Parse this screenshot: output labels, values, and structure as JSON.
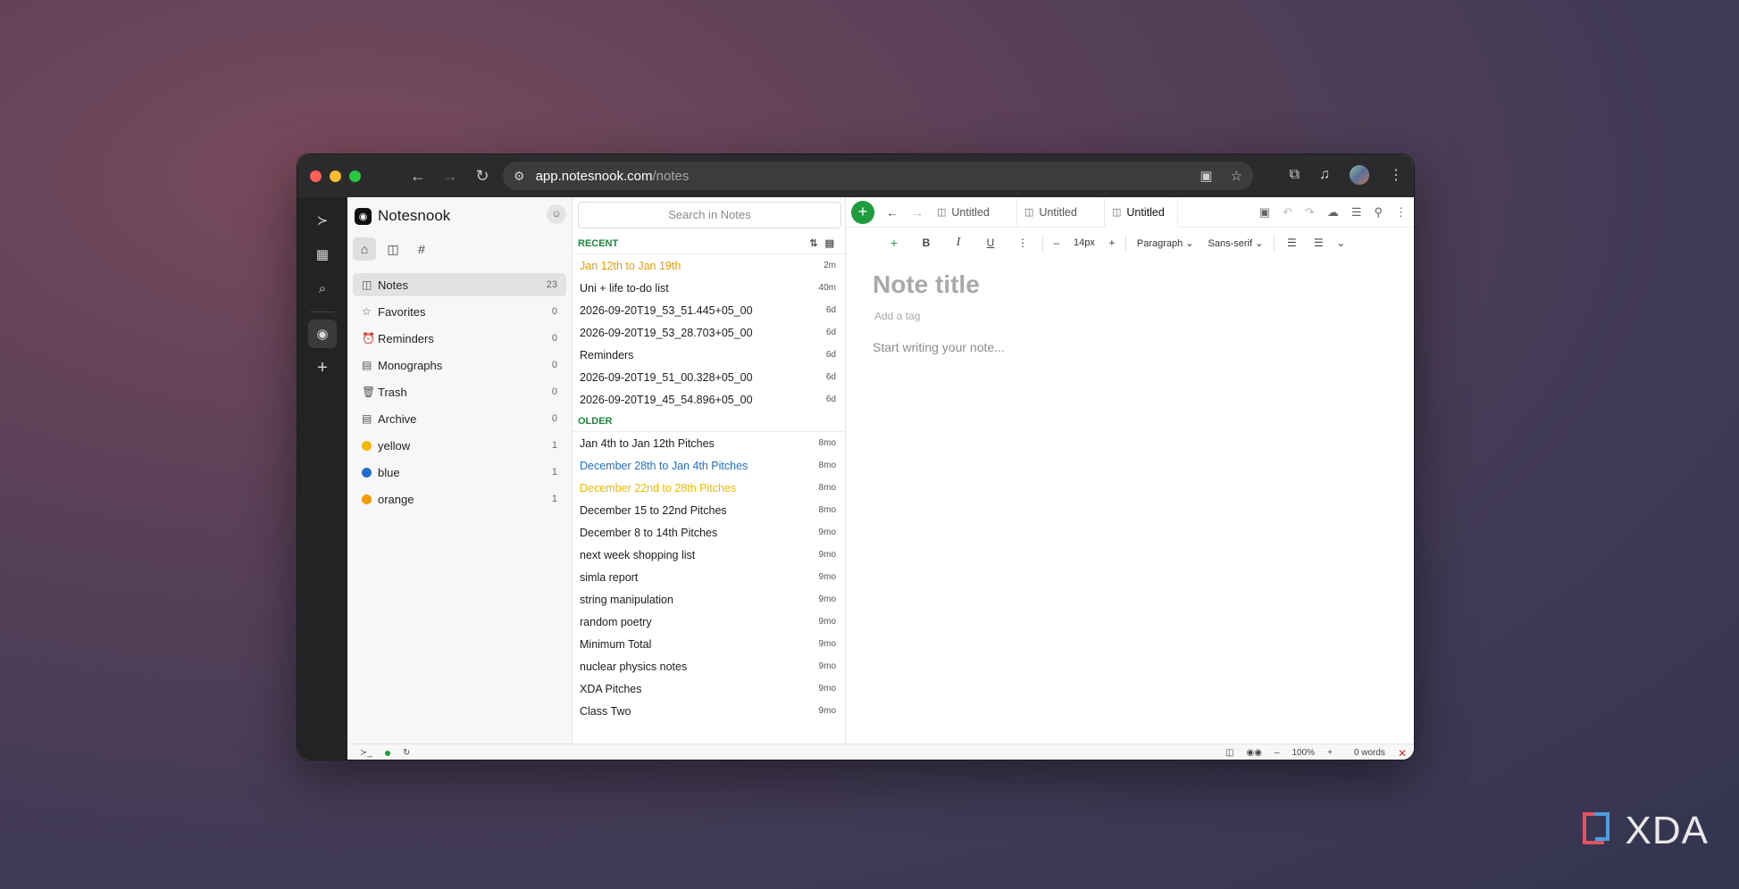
{
  "browser": {
    "url_host": "app.notesnook.com",
    "url_path": "/notes"
  },
  "sidebar": {
    "brand": "Notesnook",
    "items": [
      {
        "label": "Notes",
        "count": "23",
        "icon": "note-icon"
      },
      {
        "label": "Favorites",
        "count": "0",
        "icon": "star-icon"
      },
      {
        "label": "Reminders",
        "count": "0",
        "icon": "alarm-icon"
      },
      {
        "label": "Monographs",
        "count": "0",
        "icon": "monograph-icon"
      },
      {
        "label": "Trash",
        "count": "0",
        "icon": "trash-icon"
      },
      {
        "label": "Archive",
        "count": "0",
        "icon": "archive-icon"
      }
    ],
    "colors": [
      {
        "label": "yellow",
        "count": "1",
        "hex": "#f5b800"
      },
      {
        "label": "blue",
        "count": "1",
        "hex": "#1f6fd1"
      },
      {
        "label": "orange",
        "count": "1",
        "hex": "#f59b00"
      }
    ]
  },
  "notelist": {
    "search_placeholder": "Search in Notes",
    "recent_label": "RECENT",
    "older_label": "OLDER",
    "recent": [
      {
        "title": "Jan 12th to Jan 19th",
        "time": "2m",
        "color": "#f59b00"
      },
      {
        "title": "Uni + life to-do list",
        "time": "40m",
        "color": ""
      },
      {
        "title": "2026-09-20T19_53_51.445+05_00",
        "time": "6d",
        "color": ""
      },
      {
        "title": "2026-09-20T19_53_28.703+05_00",
        "time": "6d",
        "color": ""
      },
      {
        "title": "Reminders",
        "time": "6d",
        "color": ""
      },
      {
        "title": "2026-09-20T19_51_00.328+05_00",
        "time": "6d",
        "color": ""
      },
      {
        "title": "2026-09-20T19_45_54.896+05_00",
        "time": "6d",
        "color": ""
      }
    ],
    "older": [
      {
        "title": "Jan 4th to Jan 12th Pitches",
        "time": "8mo",
        "color": ""
      },
      {
        "title": "December 28th to Jan 4th Pitches",
        "time": "8mo",
        "color": "#1f6fd1"
      },
      {
        "title": "December 22nd to 28th Pitches",
        "time": "8mo",
        "color": "#f5b800"
      },
      {
        "title": "December 15 to 22nd Pitches",
        "time": "8mo",
        "color": ""
      },
      {
        "title": "December 8 to 14th Pitches",
        "time": "9mo",
        "color": ""
      },
      {
        "title": "next week shopping list",
        "time": "9mo",
        "color": ""
      },
      {
        "title": "simla report",
        "time": "9mo",
        "color": ""
      },
      {
        "title": "string manipulation",
        "time": "9mo",
        "color": ""
      },
      {
        "title": "random poetry",
        "time": "9mo",
        "color": ""
      },
      {
        "title": "Minimum Total",
        "time": "9mo",
        "color": ""
      },
      {
        "title": "nuclear physics notes",
        "time": "9mo",
        "color": ""
      },
      {
        "title": "XDA Pitches",
        "time": "9mo",
        "color": ""
      },
      {
        "title": "Class Two",
        "time": "9mo",
        "color": ""
      }
    ]
  },
  "editor": {
    "tabs": [
      "Untitled",
      "Untitled",
      "Untitled"
    ],
    "font_size": "14px",
    "block_type": "Paragraph",
    "font_family": "Sans-serif",
    "title_placeholder": "Note title",
    "tag_placeholder": "Add a tag",
    "body_placeholder": "Start writing your note..."
  },
  "status": {
    "zoom": "100%",
    "words": "0 words"
  },
  "watermark": "XDA"
}
